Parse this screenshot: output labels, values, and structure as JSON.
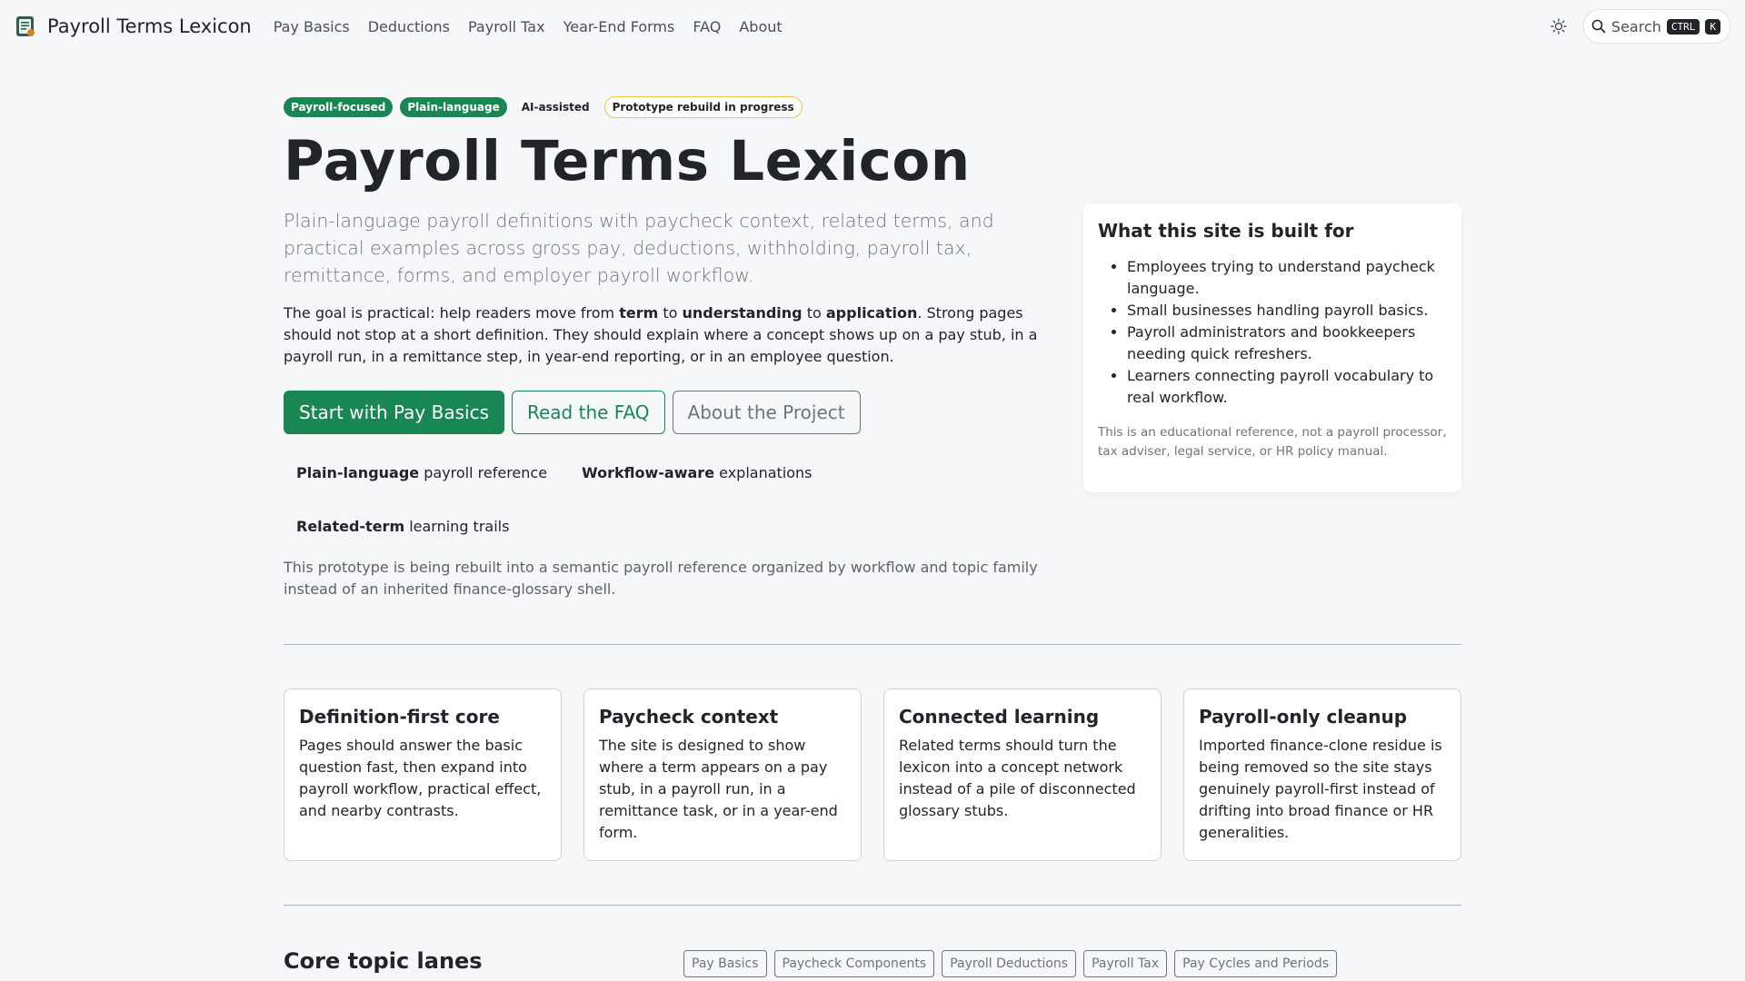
{
  "nav": {
    "brand": "Payroll Terms Lexicon",
    "links": [
      "Pay Basics",
      "Deductions",
      "Payroll Tax",
      "Year-End Forms",
      "FAQ",
      "About"
    ],
    "search_label": "Search",
    "search_kbd_1": "CTRL",
    "search_kbd_2": "K"
  },
  "hero": {
    "badges": [
      "Payroll-focused",
      "Plain-language",
      "AI-assisted",
      "Prototype rebuild in progress"
    ],
    "title": "Payroll Terms Lexicon",
    "lead": "Plain-language payroll definitions with paycheck context, related terms, and practical examples across gross pay, deductions, withholding, payroll tax, remittance, forms, and employer payroll workflow.",
    "goal": {
      "p1": "The goal is practical: help readers move from ",
      "b1": "term",
      "p2": " to ",
      "b2": "understanding",
      "p3": " to ",
      "b3": "application",
      "p4": ". Strong pages should not stop at a short definition. They should explain where a concept shows up on a pay stub, in a payroll run, in a remittance step, in year-end reporting, or in an employee question."
    },
    "cta": {
      "primary": "Start with Pay Basics",
      "faq": "Read the FAQ",
      "about": "About the Project"
    },
    "features": [
      {
        "bold": "Plain-language",
        "text": " payroll reference"
      },
      {
        "bold": "Workflow-aware",
        "text": " explanations"
      },
      {
        "bold": "Related-term",
        "text": " learning trails"
      }
    ],
    "note": "This prototype is being rebuilt into a semantic payroll reference organized by workflow and topic family instead of an inherited finance-glossary shell."
  },
  "side": {
    "title": "What this site is built for",
    "items": [
      "Employees trying to understand paycheck language.",
      "Small businesses handling payroll basics.",
      "Payroll administrators and bookkeepers needing quick refreshers.",
      "Learners connecting payroll vocabulary to real workflow."
    ],
    "note": "This is an educational reference, not a payroll processor, tax adviser, legal service, or HR policy manual."
  },
  "cards": [
    {
      "title": "Definition-first core",
      "text": "Pages should answer the basic question fast, then expand into payroll workflow, practical effect, and nearby contrasts."
    },
    {
      "title": "Paycheck context",
      "text": "The site is designed to show where a term appears on a pay stub, in a payroll run, in a remittance task, or in a year-end form."
    },
    {
      "title": "Connected learning",
      "text": "Related terms should turn the lexicon into a concept network instead of a pile of disconnected glossary stubs."
    },
    {
      "title": "Payroll-only cleanup",
      "text": "Imported finance-clone residue is being removed so the site stays genuinely payroll-first instead of drifting into broad finance or HR generalities."
    }
  ],
  "lanes": {
    "title": "Core topic lanes",
    "chips": [
      "Pay Basics",
      "Paycheck Components",
      "Payroll Deductions",
      "Payroll Tax",
      "Pay Cycles and Periods"
    ]
  },
  "colors": {
    "accent": "#198754",
    "badge_outline": "#f0c24a",
    "background": "#f6f7f9"
  }
}
